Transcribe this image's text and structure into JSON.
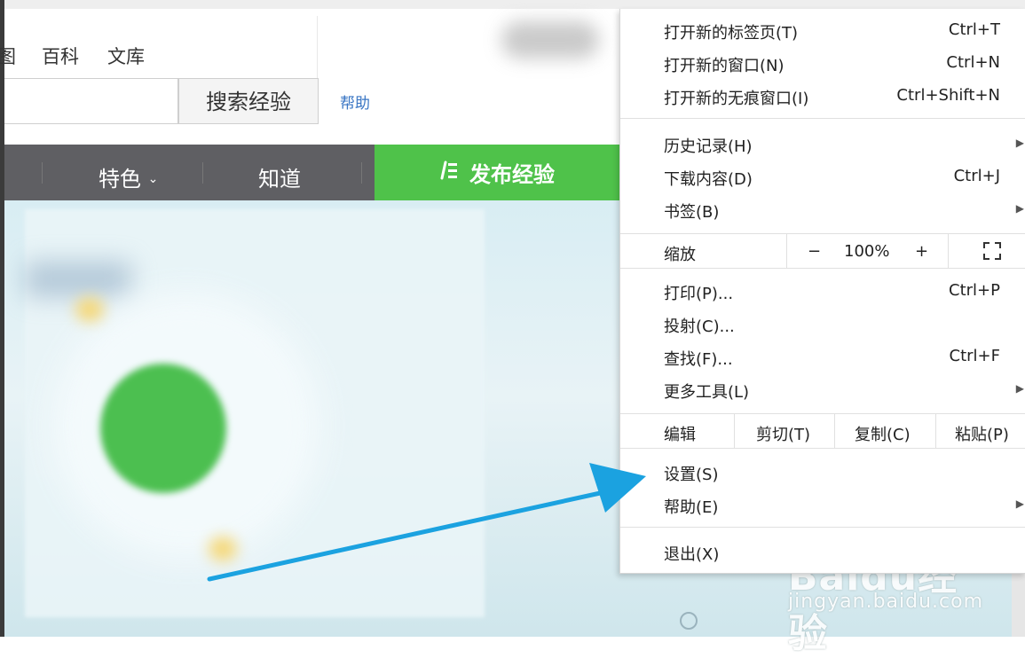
{
  "page": {
    "top_nav": [
      "图",
      "百科",
      "文库"
    ],
    "search_button": "搜索经验",
    "help_link": "帮助",
    "nav_items": [
      "特色",
      "知道"
    ],
    "nav_chevron": "chevron-down-icon",
    "publish_button": "发布经验",
    "publish_icon": "pen-list-icon"
  },
  "menu": {
    "new_tab": {
      "label": "打开新的标签页(T)",
      "shortcut": "Ctrl+T"
    },
    "new_window": {
      "label": "打开新的窗口(N)",
      "shortcut": "Ctrl+N"
    },
    "incognito": {
      "label": "打开新的无痕窗口(I)",
      "shortcut": "Ctrl+Shift+N"
    },
    "history": {
      "label": "历史记录(H)"
    },
    "downloads": {
      "label": "下载内容(D)",
      "shortcut": "Ctrl+J"
    },
    "bookmarks": {
      "label": "书签(B)"
    },
    "zoom": {
      "label": "缩放",
      "minus": "−",
      "value": "100%",
      "plus": "+"
    },
    "print": {
      "label": "打印(P)...",
      "shortcut": "Ctrl+P"
    },
    "cast": {
      "label": "投射(C)..."
    },
    "find": {
      "label": "查找(F)...",
      "shortcut": "Ctrl+F"
    },
    "more_tools": {
      "label": "更多工具(L)"
    },
    "edit": {
      "label": "编辑",
      "cut": "剪切(T)",
      "copy": "复制(C)",
      "paste": "粘贴(P)"
    },
    "settings": {
      "label": "设置(S)"
    },
    "help": {
      "label": "帮助(E)"
    },
    "exit": {
      "label": "退出(X)"
    },
    "submenu_icon": "triangle-right-icon"
  },
  "watermark": {
    "title": "Baidu经验",
    "url": "jingyan.baidu.com"
  },
  "colors": {
    "accent_green": "#4fc24a",
    "arrow_blue": "#1ba2e0",
    "nav_gray": "#5f5f63",
    "link_blue": "#3a76c4"
  }
}
